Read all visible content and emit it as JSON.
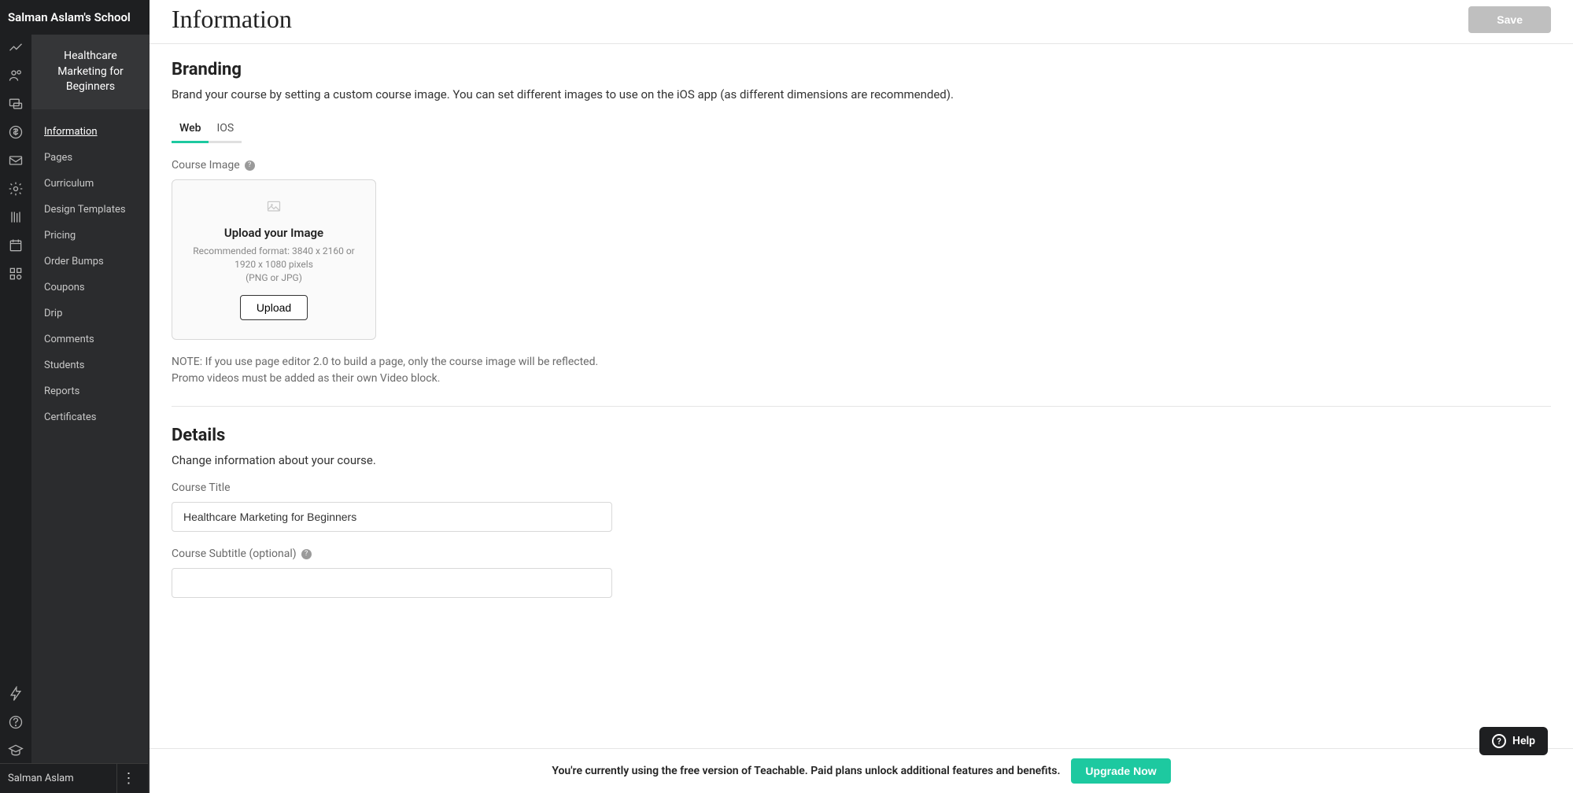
{
  "school_name": "Salman Aslam's School",
  "course_name": "Healthcare Marketing for Beginners",
  "nav": [
    "Information",
    "Pages",
    "Curriculum",
    "Design Templates",
    "Pricing",
    "Order Bumps",
    "Coupons",
    "Drip",
    "Comments",
    "Students",
    "Reports",
    "Certificates"
  ],
  "active_nav_index": 0,
  "user_name": "Salman Aslam",
  "page": {
    "title": "Information",
    "save_label": "Save"
  },
  "branding": {
    "heading": "Branding",
    "desc": "Brand your course by setting a custom course image. You can set different images to use on the iOS app (as different dimensions are recommended).",
    "tabs": [
      "Web",
      "IOS"
    ],
    "active_tab_index": 0,
    "course_image_label": "Course Image",
    "upload": {
      "title": "Upload your Image",
      "hint1": "Recommended format: 3840 x 2160 or 1920 x 1080 pixels",
      "hint2": "(PNG or JPG)",
      "button": "Upload"
    },
    "note1": "NOTE: If you use page editor 2.0 to build a page, only the course image will be reflected.",
    "note2": "Promo videos must be added as their own Video block."
  },
  "details": {
    "heading": "Details",
    "desc": "Change information about your course.",
    "course_title_label": "Course Title",
    "course_title_value": "Healthcare Marketing for Beginners",
    "course_subtitle_label": "Course Subtitle (optional)",
    "course_subtitle_value": ""
  },
  "banner": {
    "text": "You're currently using the free version of Teachable. Paid plans unlock additional features and benefits.",
    "cta": "Upgrade Now"
  },
  "help_label": "Help",
  "icons": {
    "rail": [
      "analytics-icon",
      "users-icon",
      "site-icon",
      "sales-icon",
      "emails-icon",
      "settings-icon",
      "courses-icon",
      "calendar-icon",
      "apps-icon"
    ],
    "rail_bottom": [
      "bolt-icon",
      "help-icon",
      "graduation-icon"
    ]
  }
}
